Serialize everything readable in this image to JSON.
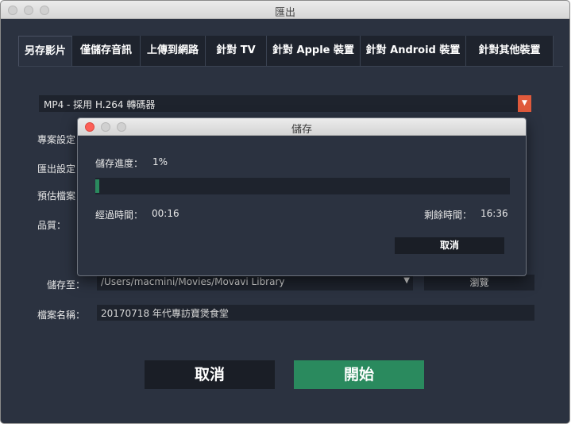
{
  "window": {
    "title": "匯出"
  },
  "tabs": [
    {
      "label": "另存影片",
      "active": true
    },
    {
      "label": "僅儲存音訊",
      "active": false
    },
    {
      "label": "上傳到網路",
      "active": false
    },
    {
      "label": "針對 TV",
      "active": false
    },
    {
      "label": "針對 Apple 裝置",
      "active": false
    },
    {
      "label": "針對 Android 裝置",
      "active": false
    },
    {
      "label": "針對其他裝置",
      "active": false
    }
  ],
  "format": {
    "selected": "MP4 - 採用 H.264 轉碼器"
  },
  "settings": {
    "project_label": "專案設定",
    "export_label": "匯出設定",
    "estimate_label": "預估檔案",
    "quality_label": "品質："
  },
  "save_to": {
    "label": "儲存至：",
    "path": "/Users/macmini/Movies/Movavi Library",
    "browse_label": "瀏覽"
  },
  "file_name": {
    "label": "檔案名稱：",
    "value": "20170718 年代專訪寶煲食堂"
  },
  "actions": {
    "cancel_label": "取消",
    "start_label": "開始"
  },
  "progress_dialog": {
    "title": "儲存",
    "progress_label": "儲存進度：",
    "progress_percent": "1%",
    "progress_value": 0.01,
    "elapsed_label": "經過時間：",
    "elapsed_value": "00:16",
    "remaining_label": "剩餘時間：",
    "remaining_value": "16:36",
    "cancel_label": "取消"
  },
  "colors": {
    "background": "#2b3240",
    "field": "#1e232d",
    "accent_green": "#2a8a5e",
    "dropdown_red": "#e05a3c"
  },
  "icons": {
    "dropdown": "chevron-down-icon"
  }
}
